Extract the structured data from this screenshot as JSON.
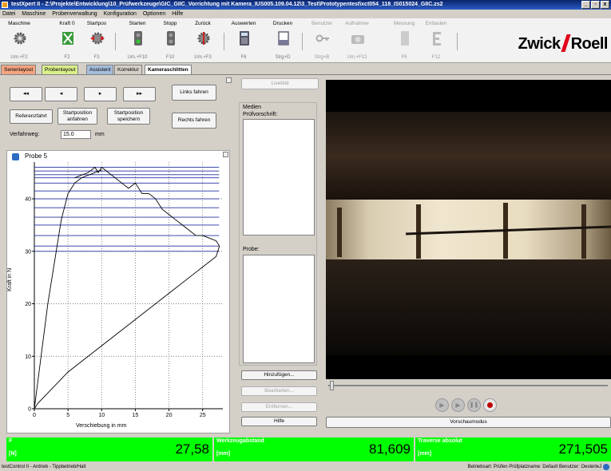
{
  "window": {
    "title": "testXpert II - Z:\\Projekte\\Entwicklung\\10_Prüfwerkzeuge\\GIC_GIIC_Vorrichtung mit Kamera_IUS005.109.04.12\\3_Test\\Prototypentest\\xct054_118_IS015024_GIIC.zs2",
    "min": "_",
    "max": "▫",
    "close": "x"
  },
  "menu": [
    "Datei",
    "Maschine",
    "Probenverwaltung",
    "Konfiguration",
    "Optionen",
    "Hilfe"
  ],
  "toolbar": [
    {
      "label": "Maschine",
      "key": "Um.+F2",
      "icon": "gear-icon"
    },
    {
      "label": "Kraft 0",
      "key": "F2",
      "icon": "force-zero-icon"
    },
    {
      "label": "Startpos",
      "key": "F3",
      "icon": "gear-arrows-icon"
    },
    {
      "label": "Starten",
      "key": "Um.+F10",
      "icon": "traffic-light-start-icon"
    },
    {
      "label": "Stopp",
      "key": "F10",
      "icon": "traffic-light-stop-icon"
    },
    {
      "label": "Zurück",
      "key": "Um.+F3",
      "icon": "gear-back-icon"
    },
    {
      "label": "Auswerten",
      "key": "F8",
      "icon": "calculator-icon"
    },
    {
      "label": "Drucken",
      "key": "Strg+D",
      "icon": "printer-icon"
    },
    {
      "label": "Benutzer",
      "key": "Strg+B",
      "icon": "key-icon"
    },
    {
      "label": "Aufnahme",
      "key": "Um.+F12",
      "icon": "camera-icon"
    },
    {
      "label": "Messung",
      "key": "F9",
      "icon": "measure-icon"
    },
    {
      "label": "Entlasten",
      "key": "F12",
      "icon": "unload-icon"
    }
  ],
  "logo": {
    "left": "Zwick",
    "right": "Roell"
  },
  "tabs": [
    {
      "label": "Serienlayout",
      "color": "#f4a582"
    },
    {
      "label": "Probenlayout",
      "color": "#d9ef8b"
    },
    {
      "label": "Assistent",
      "color": "#a6bddb"
    },
    {
      "label": "Korrektur",
      "color": "#d4d0c8"
    },
    {
      "label": "Kameraschlitten",
      "color": "#ffffff"
    }
  ],
  "controls": {
    "nav": [
      "◂◂",
      "◂",
      "▸",
      "▸▸"
    ],
    "links_fahren": "Links fahren",
    "referenzfahrt": "Referenzfahrt",
    "startpos_anfahren": "Startposition anfahren",
    "startpos_speichern": "Startposition speichern",
    "rechts_fahren": "Rechts fahren",
    "verfahrweg_label": "Verfahrweg:",
    "verfahrweg_value": "15.0",
    "verfahrweg_unit": "mm"
  },
  "chart_data": {
    "type": "line",
    "title": "Probe 5",
    "xlabel": "Verschiebung in mm",
    "ylabel": "Kraft in N",
    "xlim": [
      0,
      28
    ],
    "ylim": [
      0,
      47
    ],
    "xticks": [
      0,
      5,
      10,
      15,
      20,
      25
    ],
    "yticks": [
      0,
      10,
      20,
      30,
      40
    ],
    "series": [
      {
        "values_desc": "loading",
        "x": [
          0,
          0.5,
          1,
          1.5,
          2,
          3,
          4,
          5,
          5.5,
          6,
          7,
          8,
          9,
          10
        ],
        "y": [
          0,
          5,
          10,
          15,
          20,
          28,
          36,
          41,
          42,
          43,
          44,
          44.5,
          45,
          45.5
        ]
      },
      {
        "values_desc": "peak_and_drop",
        "x": [
          6,
          8,
          9,
          9.5,
          10,
          11,
          12,
          13,
          14,
          15,
          16,
          17,
          18,
          19,
          20,
          21,
          22,
          23,
          24,
          25,
          26,
          27,
          27.5
        ],
        "y": [
          44,
          45,
          46,
          45,
          46,
          45,
          44,
          43,
          42,
          43,
          41,
          41,
          40,
          38,
          37,
          36,
          35,
          34,
          33,
          33,
          32.5,
          32,
          31
        ]
      },
      {
        "values_desc": "unloading",
        "x": [
          27.5,
          27,
          26,
          25,
          24,
          20,
          15,
          10,
          5,
          2,
          0.5,
          0
        ],
        "y": [
          31,
          29,
          28,
          27,
          26,
          22,
          17,
          12,
          7,
          3,
          1,
          0
        ]
      }
    ],
    "hlines": [
      46,
      45.3,
      44.6,
      44,
      43,
      41.5,
      40,
      38.3,
      36.5,
      35,
      33,
      31,
      30
    ],
    "grid": true
  },
  "media": {
    "livebild": "Livebild",
    "medien_label": "Medien",
    "pruefvorschrift_label": "Prüfvorschrift:",
    "probe_label": "Probe:",
    "hinzufuegen": "Hinzufügen...",
    "bearbeiten": "Bearbeiten...",
    "entfernen": "Entfernen...",
    "hilfe": "Hilfe",
    "vorschaumodus": "Vorschaumodus"
  },
  "readouts": [
    {
      "label": "F",
      "unit": "[N]",
      "value": "27,58"
    },
    {
      "label": "Werkzeugabstand",
      "unit": "[mm]",
      "value": "81,609"
    },
    {
      "label": "Traverse absolut",
      "unit": "[mm]",
      "value": "271,505"
    }
  ],
  "statusbar": {
    "left": "testControl II - Antrieb - Tippbetrieb/Halt",
    "right": "Betriebsart: Prüfen   Prüfplatzname: Default   Benutzer: OesterleJ"
  }
}
